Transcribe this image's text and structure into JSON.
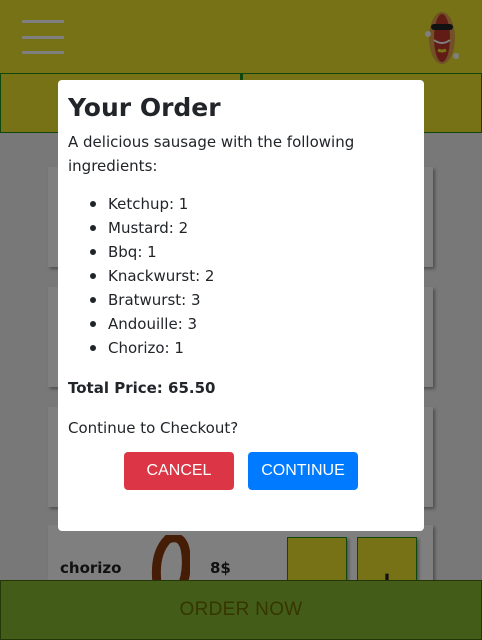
{
  "header": {
    "logo_icon": "hotdog-mascot-icon",
    "menu_icon": "hamburger-menu-icon"
  },
  "list": {
    "visible_item": {
      "name": "chorizo",
      "price": "8$",
      "minus_label": "−",
      "plus_label": "+"
    }
  },
  "footer": {
    "order_now_label": "ORDER NOW"
  },
  "modal": {
    "title": "Your Order",
    "description": "A delicious sausage with the following ingredients:",
    "ingredients": [
      "Ketchup: 1",
      "Mustard: 2",
      "Bbq: 1",
      "Knackwurst: 2",
      "Bratwurst: 3",
      "Andouille: 3",
      "Chorizo: 1"
    ],
    "total_price_label": "Total Price: 65.50",
    "question": "Continue to Checkout?",
    "cancel_label": "CANCEL",
    "continue_label": "CONTINUE"
  },
  "colors": {
    "toolbar": "#f1e52c",
    "tab_border": "#1e8e1e",
    "order_now_bg": "#86b82e",
    "cancel": "#dc3545",
    "continue": "#007bff"
  }
}
